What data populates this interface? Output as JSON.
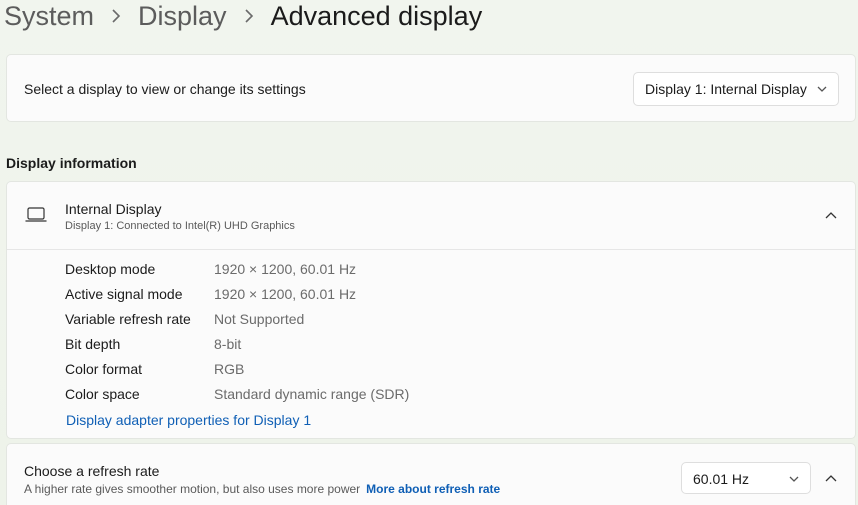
{
  "breadcrumb": {
    "items": [
      "System",
      "Display"
    ],
    "current": "Advanced display"
  },
  "display_select": {
    "label": "Select a display to view or change its settings",
    "selected": "Display 1: Internal Display"
  },
  "display_information": {
    "section_title": "Display information",
    "name": "Internal Display",
    "connection": "Display 1: Connected to Intel(R) UHD Graphics",
    "properties": [
      {
        "key": "Desktop mode",
        "value": "1920 × 1200, 60.01 Hz"
      },
      {
        "key": "Active signal mode",
        "value": "1920 × 1200, 60.01 Hz"
      },
      {
        "key": "Variable refresh rate",
        "value": "Not Supported"
      },
      {
        "key": "Bit depth",
        "value": "8-bit"
      },
      {
        "key": "Color format",
        "value": "RGB"
      },
      {
        "key": "Color space",
        "value": "Standard dynamic range (SDR)"
      }
    ],
    "adapter_link": "Display adapter properties for Display 1"
  },
  "refresh_rate": {
    "title": "Choose a refresh rate",
    "description": "A higher rate gives smoother motion, but also uses more power",
    "link": "More about refresh rate",
    "selected": "60.01 Hz"
  },
  "icons": {
    "separator": "chevron-right-icon",
    "dropdown": "chevron-down-icon",
    "collapse": "chevron-up-icon",
    "display": "laptop-icon"
  },
  "colors": {
    "link": "#0f5fb5",
    "background": "#eef3ea",
    "card": "#fbfbfb"
  }
}
